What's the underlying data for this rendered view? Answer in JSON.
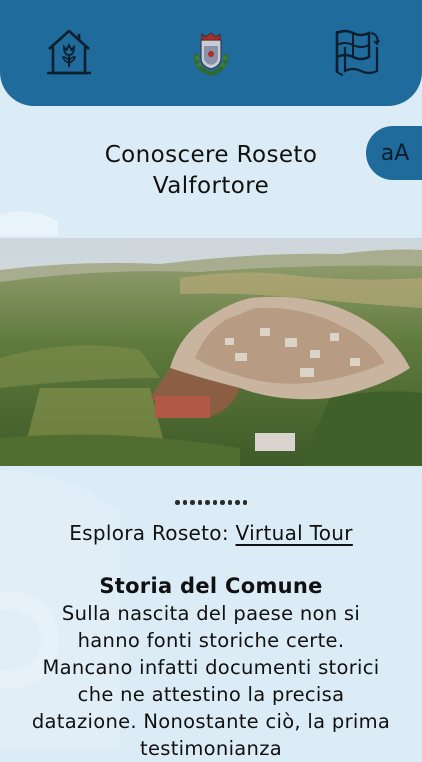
{
  "header": {
    "home_icon": "house-tulip-icon",
    "crest_icon": "coat-of-arms-icon",
    "language_icon": "flags-switch-icon",
    "colors": {
      "primary": "#1f6b9b",
      "background": "#dcecf7"
    }
  },
  "page": {
    "title_line1": "Conoscere Roseto",
    "title_line2": "Valfortore",
    "font_toggle_label": "aA"
  },
  "carousel": {
    "image_name": "aerial-view-roseto-valfortore",
    "dot_count": 10,
    "active_index": 0
  },
  "explore": {
    "prefix": "Esplora Roseto: ",
    "link_label": "Virtual Tour"
  },
  "history": {
    "title": "Storia del Comune",
    "text": "Sulla nascita del paese non si hanno fonti storiche certe. Mancano infatti documenti storici che ne attestino la precisa datazione. Nonostante ciò, la prima testimonianza"
  }
}
